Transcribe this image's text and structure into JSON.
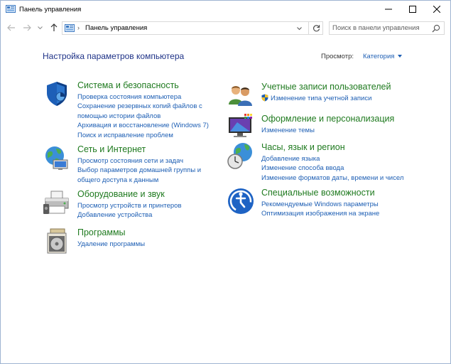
{
  "window": {
    "title": "Панель управления"
  },
  "address": {
    "crumb": "Панель управления",
    "separator": "›"
  },
  "search": {
    "placeholder": "Поиск в панели управления"
  },
  "content": {
    "heading": "Настройка параметров компьютера",
    "view_by_label": "Просмотр:",
    "view_by_value": "Категория"
  },
  "categories_left": [
    {
      "title": "Система и безопасность",
      "icon": "shield-icon",
      "links": [
        "Проверка состояния компьютера",
        "Сохранение резервных копий файлов с помощью истории файлов",
        "Архивация и восстановление (Windows 7)",
        "Поиск и исправление проблем"
      ]
    },
    {
      "title": "Сеть и Интернет",
      "icon": "network-globe-icon",
      "links": [
        "Просмотр состояния сети и задач",
        "Выбор параметров домашней группы и общего доступа к данным"
      ]
    },
    {
      "title": "Оборудование и звук",
      "icon": "printer-icon",
      "links": [
        "Просмотр устройств и принтеров",
        "Добавление устройства"
      ]
    },
    {
      "title": "Программы",
      "icon": "programs-disc-icon",
      "links": [
        "Удаление программы"
      ]
    }
  ],
  "categories_right": [
    {
      "title": "Учетные записи пользователей",
      "icon": "users-icon",
      "links": [
        "Изменение типа учетной записи"
      ]
    },
    {
      "title": "Оформление и персонализация",
      "icon": "monitor-palette-icon",
      "links": [
        "Изменение темы"
      ]
    },
    {
      "title": "Часы, язык и регион",
      "icon": "clock-globe-icon",
      "links": [
        "Добавление языка",
        "Изменение способа ввода",
        "Изменение форматов даты, времени и чисел"
      ]
    },
    {
      "title": "Специальные возможности",
      "icon": "accessibility-icon",
      "links": [
        "Рекомендуемые Windows параметры",
        "Оптимизация изображения на экране"
      ]
    }
  ],
  "colors": {
    "heading": "#1e3287",
    "category_title": "#1f7a1f",
    "link": "#1e5fb4"
  }
}
